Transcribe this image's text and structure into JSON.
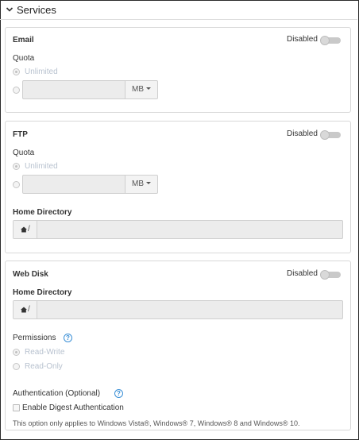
{
  "header": {
    "title": "Services"
  },
  "email": {
    "title": "Email",
    "toggle_label": "Disabled",
    "quota_label": "Quota",
    "unlimited_label": "Unlimited",
    "unit": "MB"
  },
  "ftp": {
    "title": "FTP",
    "toggle_label": "Disabled",
    "quota_label": "Quota",
    "unlimited_label": "Unlimited",
    "unit": "MB",
    "home_dir_label": "Home Directory",
    "home_prefix": "/"
  },
  "webdisk": {
    "title": "Web Disk",
    "toggle_label": "Disabled",
    "home_dir_label": "Home Directory",
    "home_prefix": "/",
    "permissions_label": "Permissions",
    "perm_options": [
      "Read-Write",
      "Read-Only"
    ],
    "auth_label": "Authentication (Optional)",
    "digest_label": "Enable Digest Authentication",
    "note": "This option only applies to Windows Vista®, Windows® 7, Windows® 8 and Windows® 10.",
    "help_glyph": "?"
  },
  "colors": {
    "accent": "#3a8fd6",
    "disabled_text": "#b8c2cf"
  },
  "icons": {
    "chevron": "chevron-down-icon",
    "home": "home-icon",
    "help": "help-circle-icon"
  }
}
